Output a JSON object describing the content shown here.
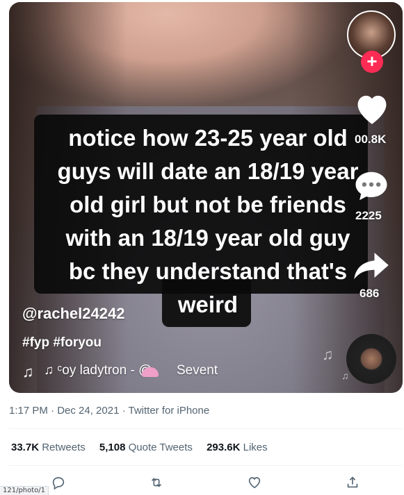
{
  "video": {
    "caption": "notice how 23-25 year old\nguys will date an 18/19 year\nold girl but not be friends\nwith an 18/19 year old guy\nbc they understand that's\nweird",
    "handle": "@rachel24242",
    "hashtags": "#fyp #foryou",
    "sound_text": "♫  ᶜoy ladytron - @",
    "sound_suffix": "Sevent",
    "likes_count": "00.8K",
    "comments_count": "2225",
    "shares_count": "686",
    "follow_symbol": "+",
    "music_symbol": "♫"
  },
  "tweet": {
    "timestamp": "1:17 PM · Dec 24, 2021 · Twitter for iPhone",
    "retweets_count": "33.7K",
    "retweets_label": "Retweets",
    "quotes_count": "5,108",
    "quotes_label": "Quote Tweets",
    "likes_count": "293.6K",
    "likes_label": "Likes"
  },
  "actions": {
    "reply_icon": "reply-icon",
    "retweet_icon": "retweet-icon",
    "like_icon": "heart-icon",
    "share_icon": "share-icon"
  },
  "status_bar": {
    "url": "121/photo/1"
  },
  "colors": {
    "tiktok_red": "#fe2c55",
    "muted_text": "#536471",
    "primary_text": "#0f1419"
  }
}
